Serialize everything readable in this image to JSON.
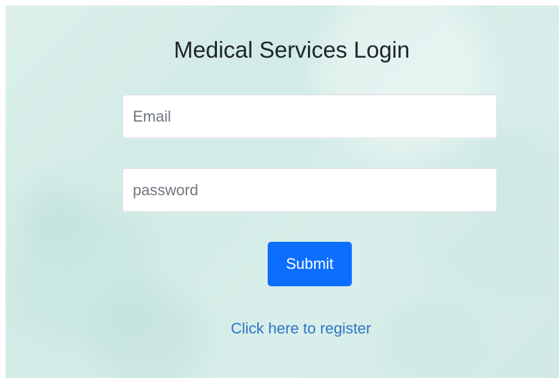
{
  "login": {
    "title": "Medical Services Login",
    "email_placeholder": "Email",
    "password_placeholder": "password",
    "submit_label": "Submit",
    "register_link": "Click here to register"
  },
  "colors": {
    "background": "#d6ece8",
    "input_background": "#ffffff",
    "submit_button": "#0d6efd",
    "register_link": "#2f74c7",
    "title_text": "#1f2529"
  }
}
